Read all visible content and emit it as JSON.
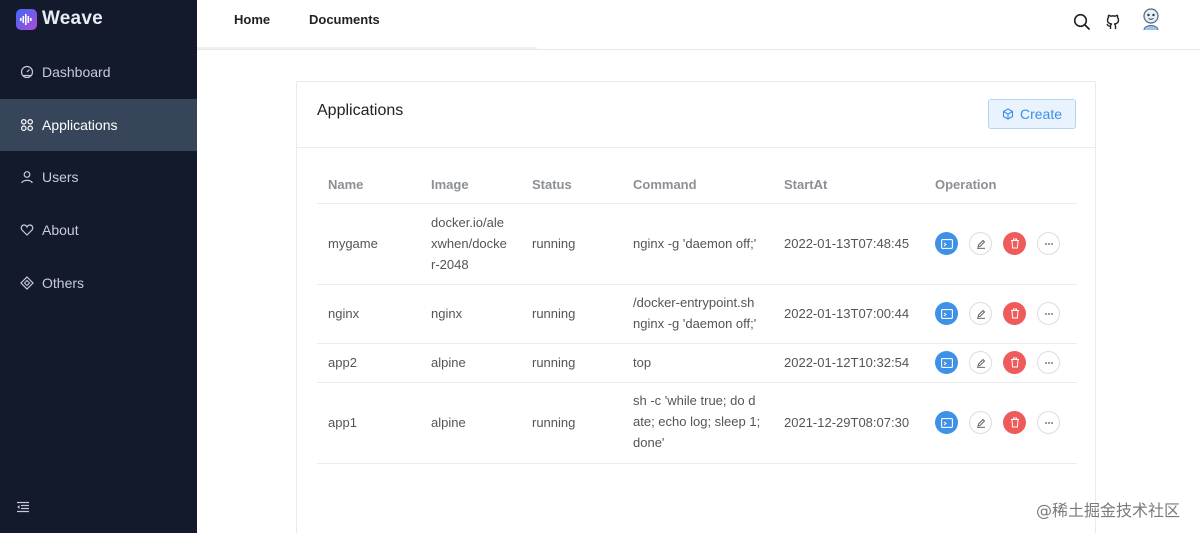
{
  "app": {
    "name": "Weave"
  },
  "sidebar": {
    "items": [
      {
        "label": "Dashboard",
        "icon": "dashboard-icon",
        "active": false
      },
      {
        "label": "Applications",
        "icon": "apps-icon",
        "active": true
      },
      {
        "label": "Users",
        "icon": "user-icon",
        "active": false
      },
      {
        "label": "About",
        "icon": "heart-icon",
        "active": false
      },
      {
        "label": "Others",
        "icon": "diamond-icon",
        "active": false
      }
    ],
    "collapse_icon": "collapse-menu-icon"
  },
  "header": {
    "nav": [
      {
        "label": "Home"
      },
      {
        "label": "Documents"
      }
    ],
    "icons": [
      "search-icon",
      "github-icon",
      "avatar"
    ]
  },
  "card": {
    "title": "Applications",
    "create_label": "Create",
    "columns": [
      "Name",
      "Image",
      "Status",
      "Command",
      "StartAt",
      "Operation"
    ],
    "rows": [
      {
        "name": "mygame",
        "image_lines": [
          "docker.io/ale",
          "xwhen/docke",
          "r-2048"
        ],
        "status": "running",
        "command_lines": [
          "nginx -g 'daemon off;'"
        ],
        "start_at": "2022-01-13T07:48:45"
      },
      {
        "name": "nginx",
        "image_lines": [
          "nginx"
        ],
        "status": "running",
        "command_lines": [
          "/docker-entrypoint.sh",
          "nginx -g 'daemon off;'"
        ],
        "start_at": "2022-01-13T07:00:44"
      },
      {
        "name": "app2",
        "image_lines": [
          "alpine"
        ],
        "status": "running",
        "command_lines": [
          "top"
        ],
        "start_at": "2022-01-12T10:32:54"
      },
      {
        "name": "app1",
        "image_lines": [
          "alpine"
        ],
        "status": "running",
        "command_lines": [
          "sh -c 'while true; do d",
          "ate; echo log; sleep 1;",
          "done'"
        ],
        "start_at": "2021-12-29T08:07:30"
      }
    ],
    "operations": [
      {
        "icon": "terminal-icon",
        "color": "#3d91e7"
      },
      {
        "icon": "edit-icon",
        "color": "#ffffff"
      },
      {
        "icon": "delete-icon",
        "color": "#ef5a5a"
      },
      {
        "icon": "more-icon",
        "color": "#ffffff"
      }
    ]
  },
  "watermark": "@稀土掘金技术社区"
}
